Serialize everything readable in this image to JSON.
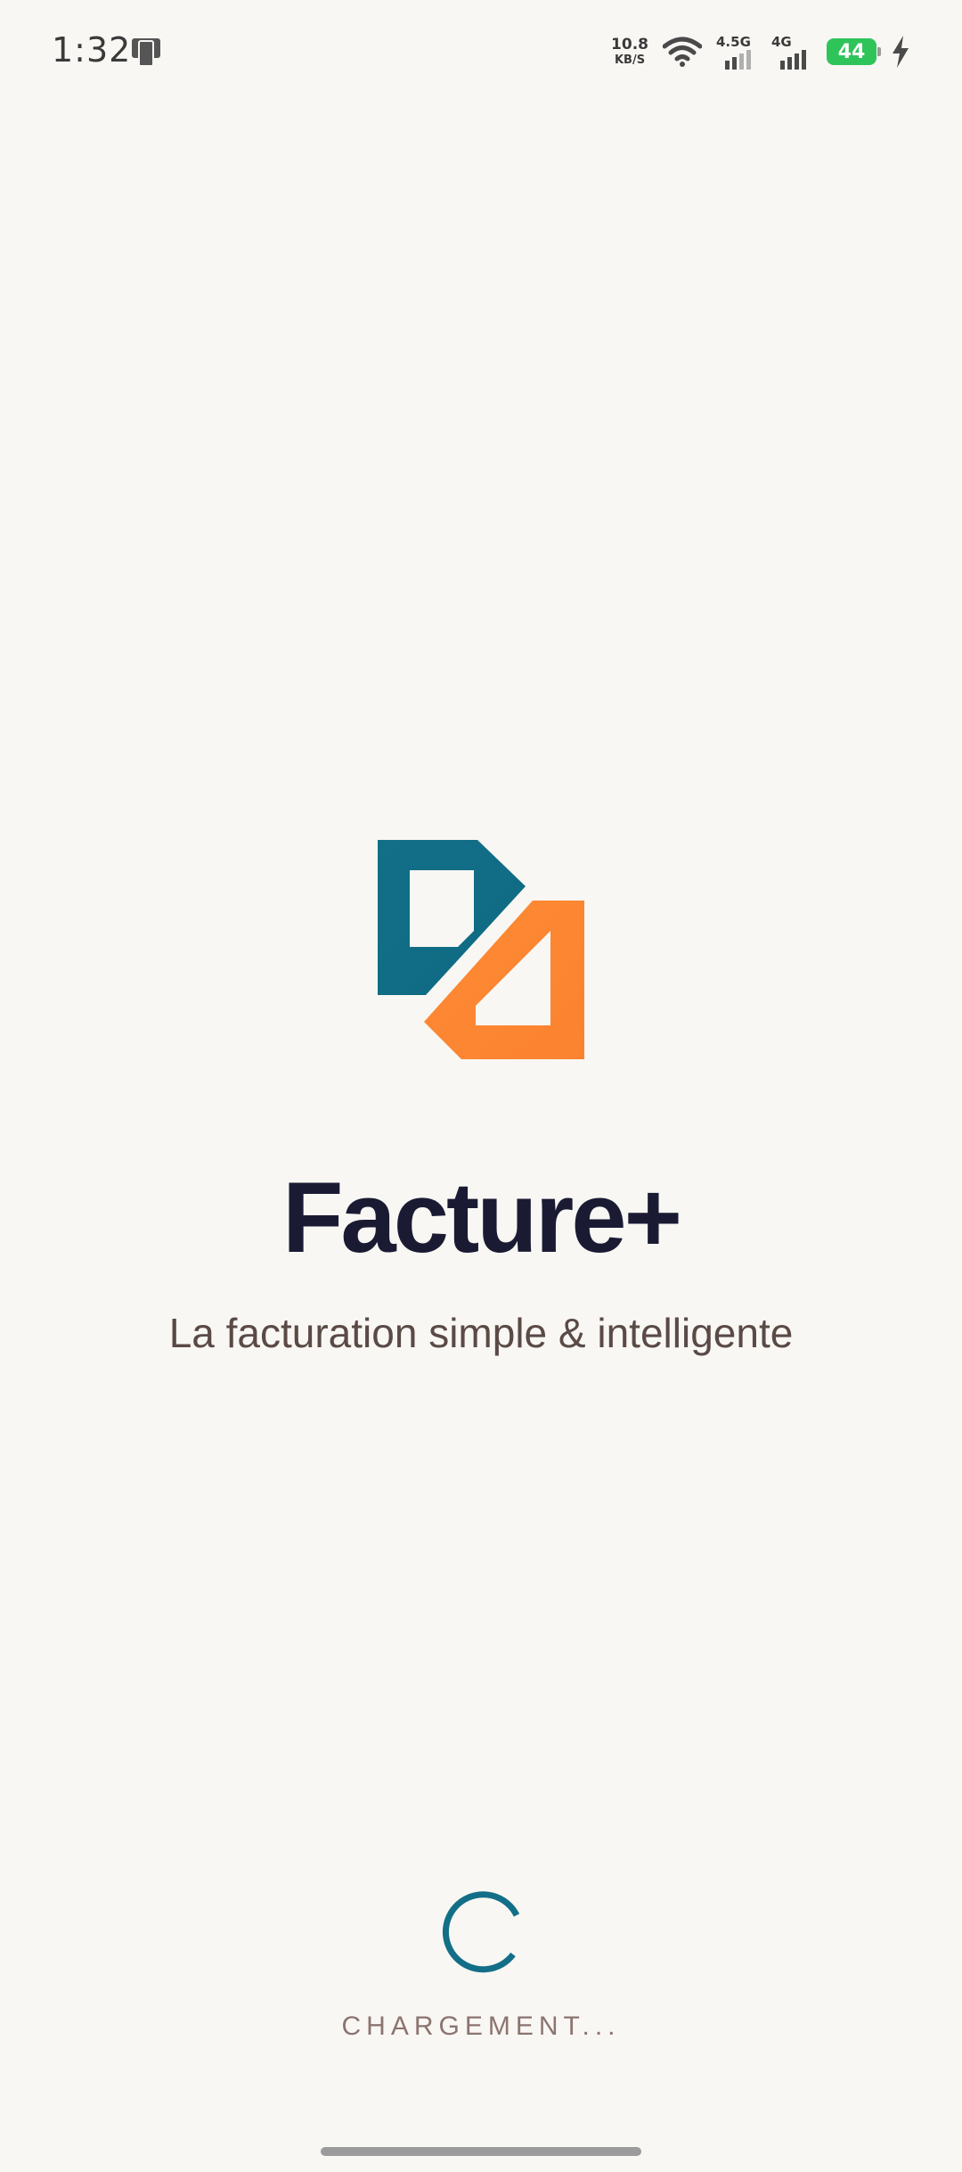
{
  "status_bar": {
    "time": "1:32",
    "net_speed_value": "10.8",
    "net_speed_unit": "KB/S",
    "signal1_label": "4.5G",
    "signal2_label": "4G",
    "battery_level": "44"
  },
  "app": {
    "title": "Facture+",
    "tagline": "La facturation simple & intelligente"
  },
  "loading": {
    "text": "CHARGEMENT..."
  },
  "colors": {
    "background": "#f9f7f4",
    "brand_teal": "#136f88",
    "brand_orange": "#fd8531",
    "title": "#1a1b33",
    "tagline": "#5a4a46",
    "loading_text": "#8c7470",
    "battery": "#2fc45a"
  }
}
